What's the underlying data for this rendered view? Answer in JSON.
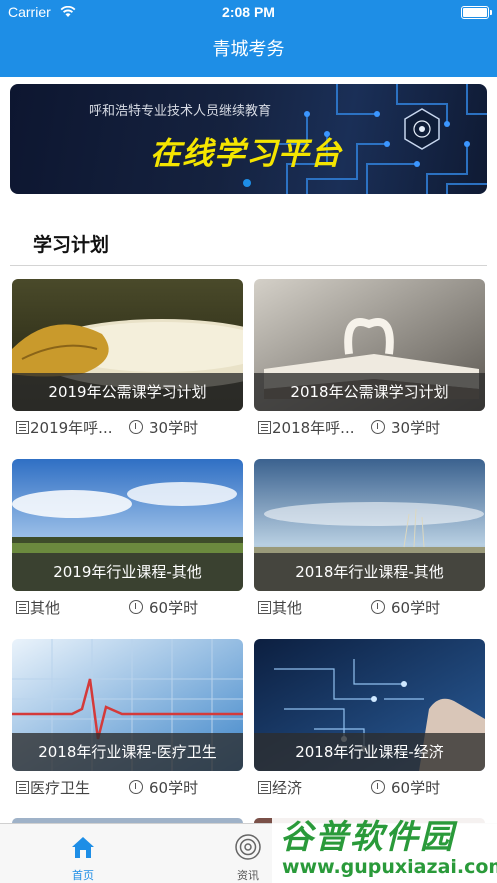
{
  "status_bar": {
    "carrier": "Carrier",
    "time": "2:08 PM"
  },
  "nav": {
    "title": "青城考务"
  },
  "banner": {
    "subtitle": "呼和浩特专业技术人员继续教育",
    "headline": "在线学习平台",
    "page_index": 0,
    "page_count": 1
  },
  "section": {
    "title": "学习计划"
  },
  "plans": [
    {
      "title": "2019年公需课学习计划",
      "category": "2019年呼...",
      "hours": "30学时"
    },
    {
      "title": "2018年公需课学习计划",
      "category": "2018年呼...",
      "hours": "30学时"
    },
    {
      "title": "2019年行业课程-其他",
      "category": "其他",
      "hours": "60学时"
    },
    {
      "title": "2018年行业课程-其他",
      "category": "其他",
      "hours": "60学时"
    },
    {
      "title": "2018年行业课程-医疗卫生",
      "category": "医疗卫生",
      "hours": "60学时"
    },
    {
      "title": "2018年行业课程-经济",
      "category": "经济",
      "hours": "60学时"
    }
  ],
  "tabbar": {
    "items": [
      {
        "label": "首页",
        "icon": "home-icon",
        "active": true
      },
      {
        "label": "资讯",
        "icon": "news-icon",
        "active": false
      }
    ]
  },
  "watermark": {
    "title": "谷普软件园",
    "url": "www.gupuxiazai.com"
  },
  "colors": {
    "primary": "#1e8ee6",
    "banner_text": "#f5e500",
    "watermark": "#2a9a3a"
  }
}
